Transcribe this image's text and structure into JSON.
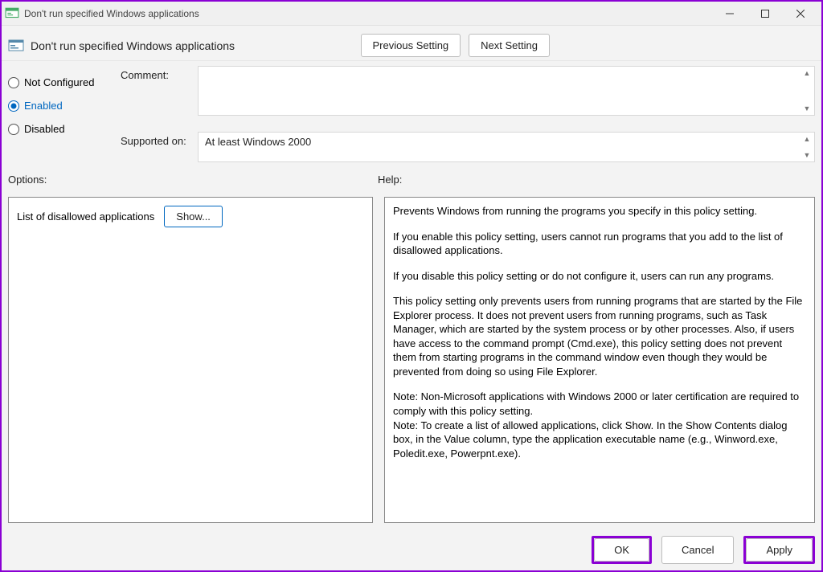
{
  "window": {
    "title": "Don't run specified Windows applications"
  },
  "header": {
    "policy_title": "Don't run specified Windows applications",
    "prev_btn": "Previous Setting",
    "next_btn": "Next Setting"
  },
  "state": {
    "not_configured": "Not Configured",
    "enabled": "Enabled",
    "disabled": "Disabled",
    "selected": "enabled"
  },
  "meta": {
    "comment_label": "Comment:",
    "comment_value": "",
    "supported_label": "Supported on:",
    "supported_value": "At least Windows 2000"
  },
  "panels": {
    "options_label": "Options:",
    "help_label": "Help:"
  },
  "options": {
    "disallowed_label": "List of disallowed applications",
    "show_btn": "Show..."
  },
  "help": {
    "p1": "Prevents Windows from running the programs you specify in this policy setting.",
    "p2": "If you enable this policy setting, users cannot run programs that you add to the list of disallowed applications.",
    "p3": "If you disable this policy setting or do not configure it, users can run any programs.",
    "p4": "This policy setting only prevents users from running programs that are started by the File Explorer process. It does not prevent users from running programs, such as Task Manager, which are started by the system process or by other processes.  Also, if users have access to the command prompt (Cmd.exe), this policy setting does not prevent them from starting programs in the command window even though they would be prevented from doing so using File Explorer.",
    "p5": "Note: Non-Microsoft applications with Windows 2000 or later certification are required to comply with this policy setting.",
    "p6": "Note: To create a list of allowed applications, click Show.  In the Show Contents dialog box, in the Value column, type the application executable name (e.g., Winword.exe, Poledit.exe, Powerpnt.exe)."
  },
  "footer": {
    "ok": "OK",
    "cancel": "Cancel",
    "apply": "Apply"
  }
}
